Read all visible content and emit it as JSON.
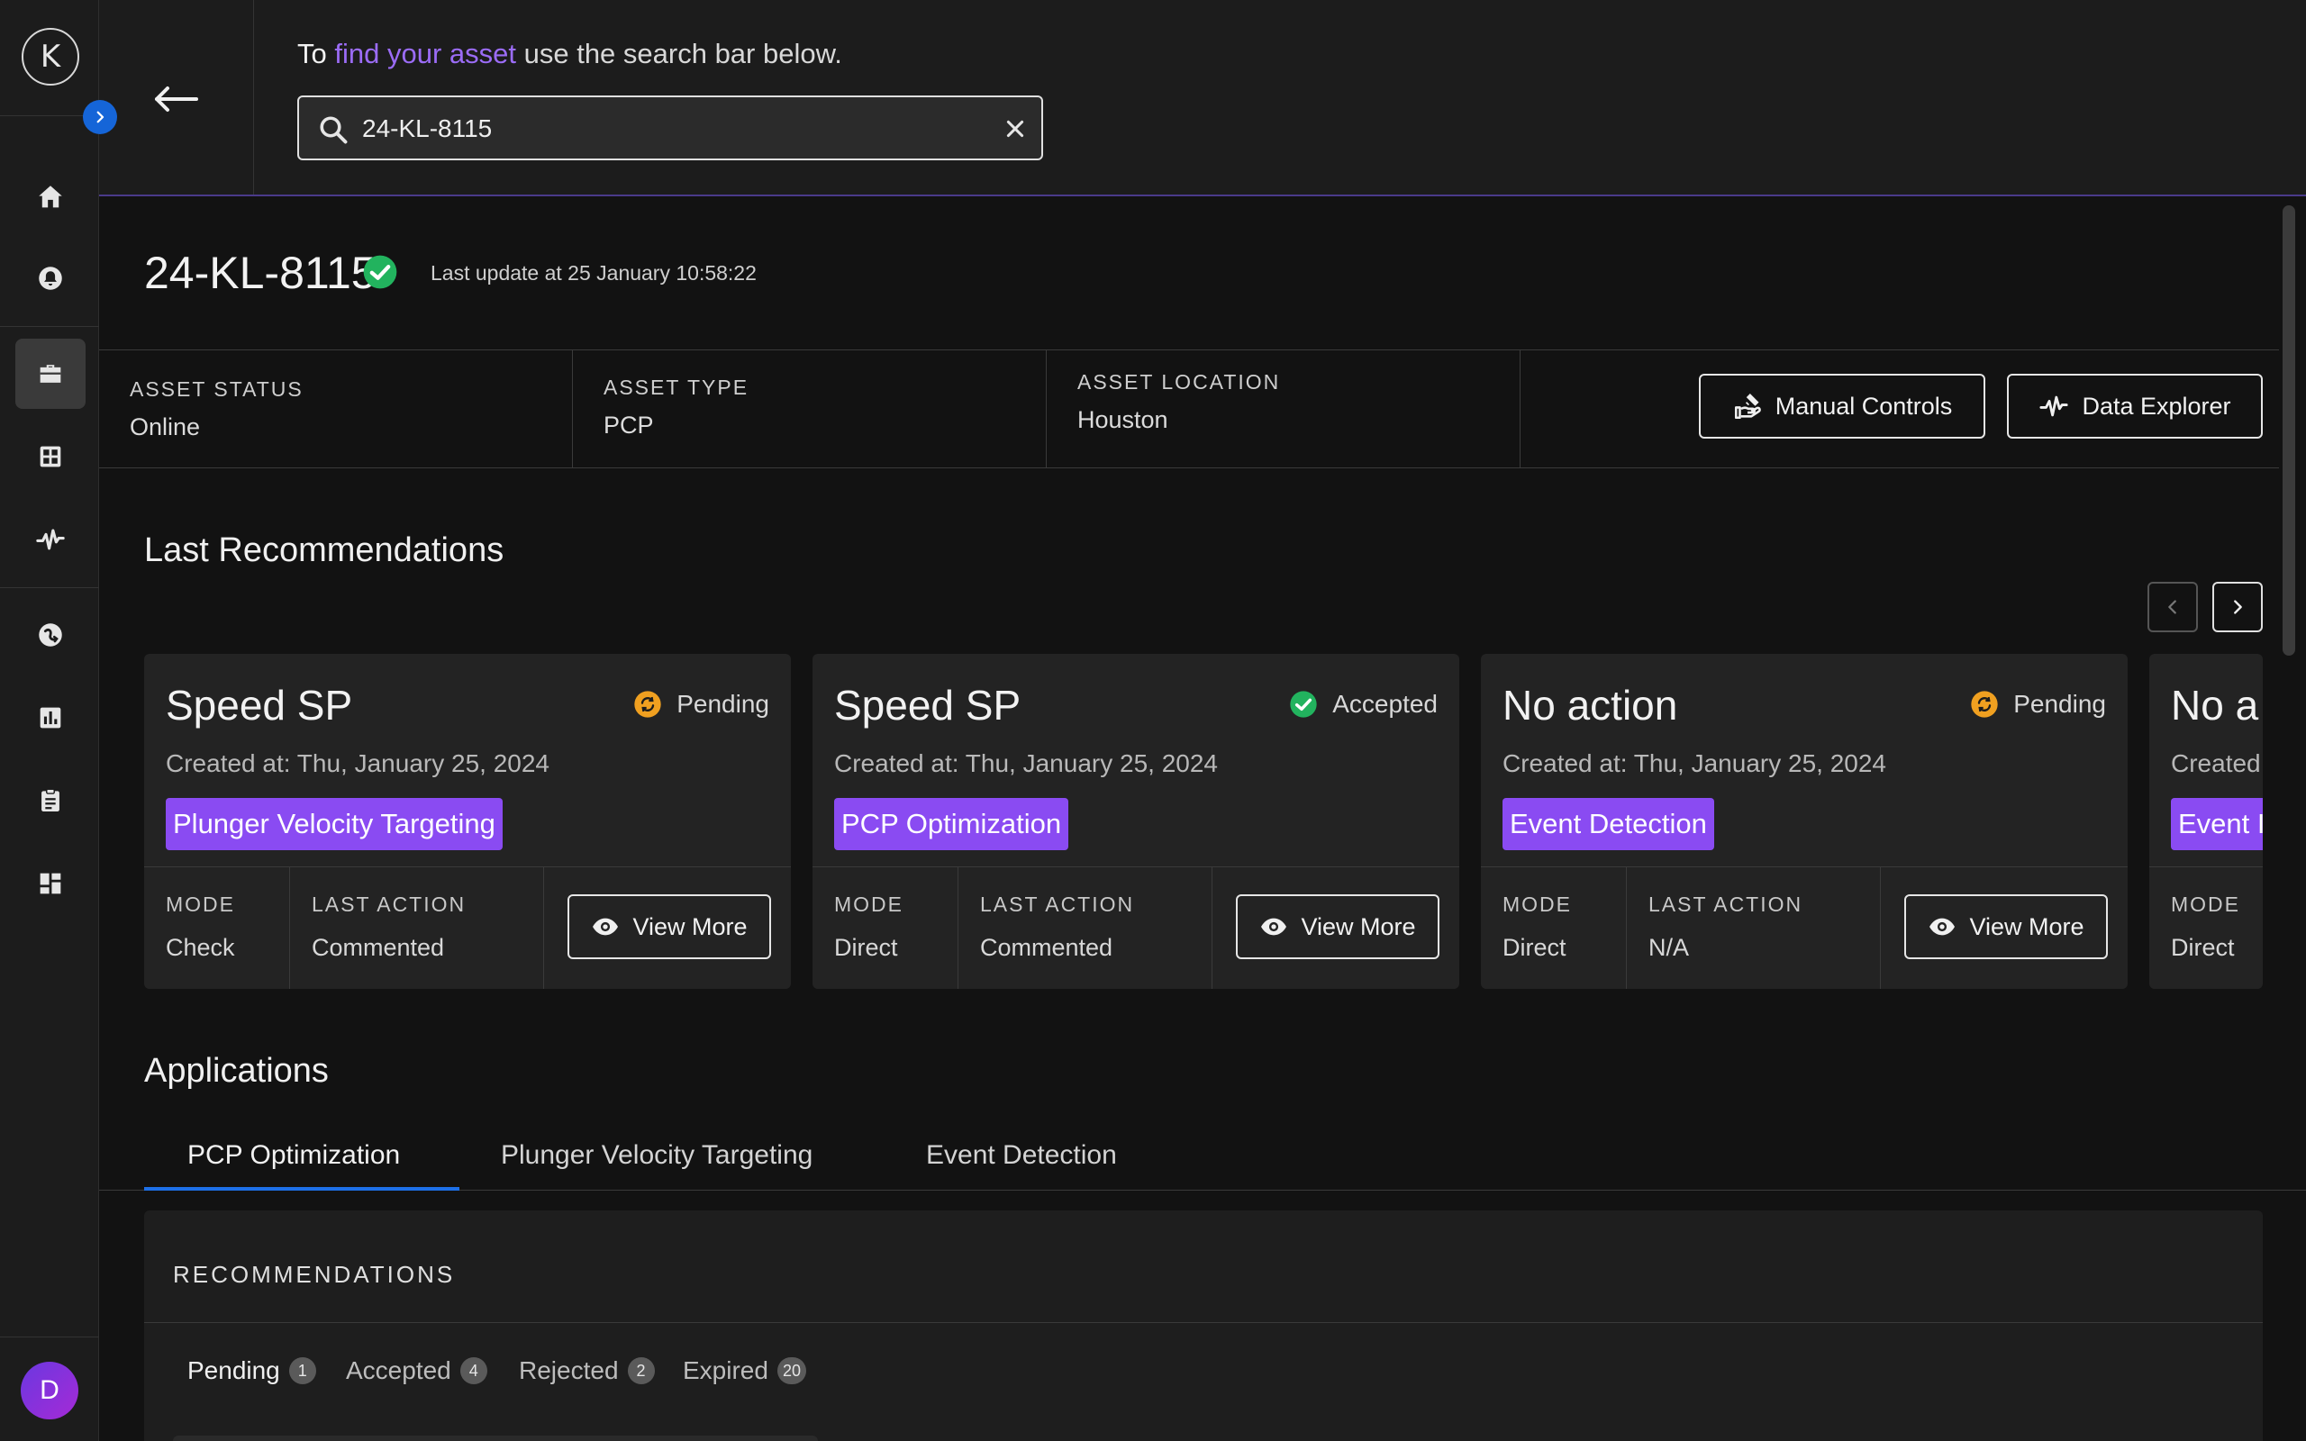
{
  "sidebar": {
    "logo_letter": "K",
    "avatar_initial": "D",
    "items": [
      {
        "icon": "home-icon"
      },
      {
        "icon": "alerts-icon"
      },
      {
        "icon": "assets-icon",
        "active": true
      },
      {
        "icon": "dashboard-grid-icon"
      },
      {
        "icon": "pulse-icon"
      },
      {
        "icon": "history-icon"
      },
      {
        "icon": "bar-chart-icon"
      },
      {
        "icon": "clipboard-icon"
      },
      {
        "icon": "layout-icon"
      }
    ]
  },
  "header": {
    "hint_lead": "To",
    "hint_link": "find your asset",
    "hint_tail": "use the search bar below.",
    "search_value": "24-KL-8115"
  },
  "asset": {
    "title": "24-KL-8115",
    "last_update": "Last update at 25 January 10:58:22",
    "status_label": "ASSET STATUS",
    "status_value": "Online",
    "type_label": "ASSET TYPE",
    "type_value": "PCP",
    "location_label": "ASSET LOCATION",
    "location_value": "Houston",
    "manual_controls_label": "Manual Controls",
    "data_explorer_label": "Data Explorer"
  },
  "recommendations": {
    "heading": "Last Recommendations",
    "mode_label": "MODE",
    "last_action_label": "LAST ACTION",
    "view_more_label": "View More",
    "cards": [
      {
        "title": "Speed SP",
        "status": "Pending",
        "created": "Created at: Thu, January 25, 2024",
        "tag": "Plunger Velocity Targeting",
        "mode": "Check",
        "last_action": "Commented"
      },
      {
        "title": "Speed SP",
        "status": "Accepted",
        "created": "Created at: Thu, January 25, 2024",
        "tag": "PCP Optimization",
        "mode": "Direct",
        "last_action": "Commented"
      },
      {
        "title": "No action",
        "status": "Pending",
        "created": "Created at: Thu, January 25, 2024",
        "tag": "Event Detection",
        "mode": "Direct",
        "last_action": "N/A"
      },
      {
        "title": "No a",
        "created": "Created",
        "tag": "Event I",
        "mode": "Direct"
      }
    ]
  },
  "applications": {
    "heading": "Applications",
    "tabs": [
      "PCP Optimization",
      "Plunger Velocity Targeting",
      "Event Detection"
    ],
    "panel_title": "RECOMMENDATIONS",
    "sub_tabs": [
      {
        "label": "Pending",
        "count": "1"
      },
      {
        "label": "Accepted",
        "count": "4"
      },
      {
        "label": "Rejected",
        "count": "2"
      },
      {
        "label": "Expired",
        "count": "20"
      }
    ]
  },
  "colors": {
    "accent_purple": "#8a4bf2",
    "tab_underline_blue": "#1d70e8",
    "status_green": "#22b35e",
    "status_pending_orange": "#f0a020"
  }
}
